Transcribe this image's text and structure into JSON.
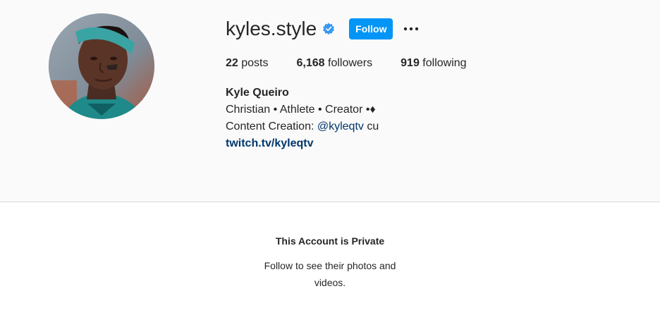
{
  "profile": {
    "username": "kyles.style",
    "verified": true,
    "follow_label": "Follow",
    "more_icon": "ellipsis-icon",
    "avatar_icon": "profile-photo"
  },
  "stats": {
    "posts_count": "22",
    "posts_label": "posts",
    "followers_count": "6,168",
    "followers_label": "followers",
    "following_count": "919",
    "following_label": "following"
  },
  "bio": {
    "name": "Kyle Queiro",
    "line1": "Christian • Athlete • Creator •♦",
    "line2_prefix": "Content Creation: ",
    "line2_mention": "@kyleqtv",
    "line2_suffix": " cu",
    "link": "twitch.tv/kyleqtv"
  },
  "private_notice": {
    "title": "This Account is Private",
    "subtitle": "Follow to see their photos and videos."
  },
  "colors": {
    "accent": "#0095f6",
    "verified_badge": "#3897f0",
    "link": "#00376b",
    "background": "#fafafa"
  }
}
